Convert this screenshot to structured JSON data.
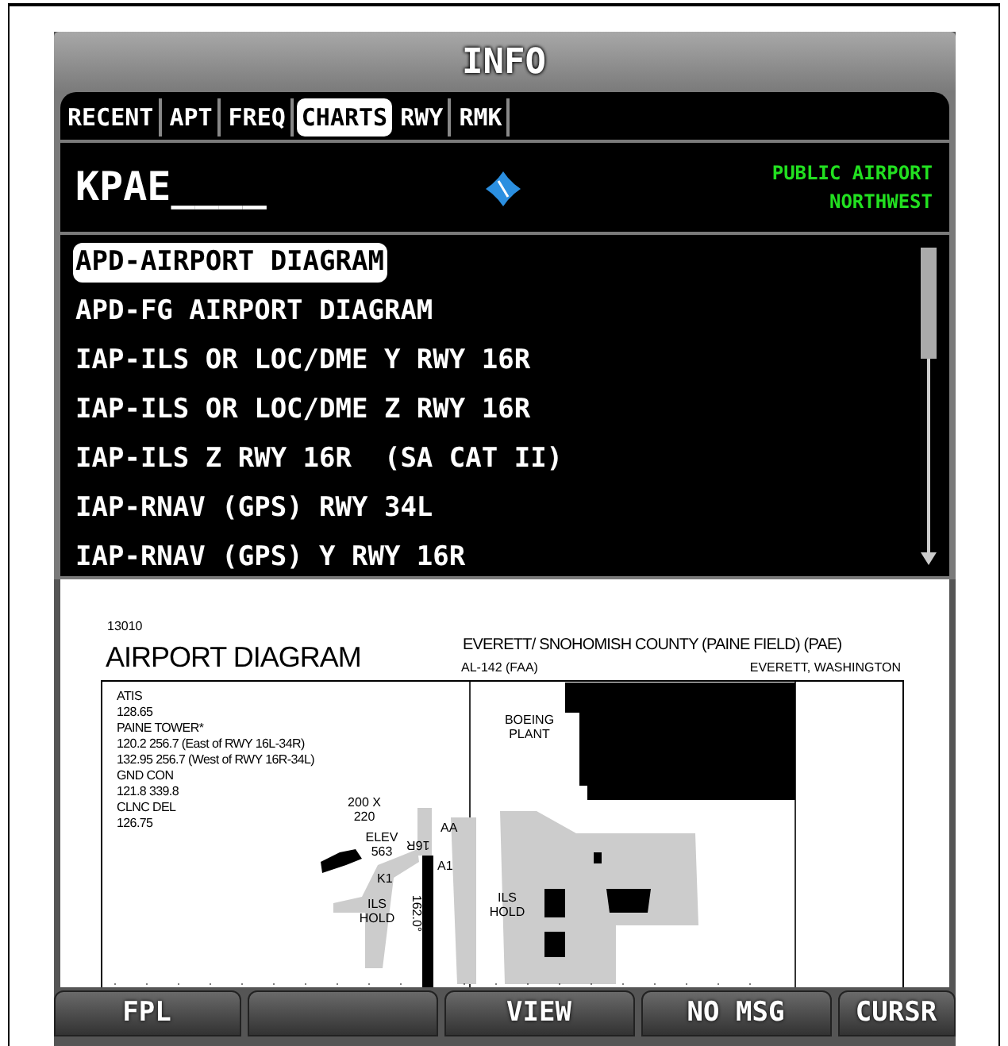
{
  "window": {
    "title": "INFO"
  },
  "tabs": [
    {
      "label": "RECENT",
      "selected": false
    },
    {
      "label": "APT",
      "selected": false
    },
    {
      "label": "FREQ",
      "selected": false
    },
    {
      "label": "CHARTS",
      "selected": true
    },
    {
      "label": "RWY",
      "selected": false
    },
    {
      "label": "RMK",
      "selected": false
    }
  ],
  "airport": {
    "identifier": "KPAE____",
    "type": "PUBLIC AIRPORT",
    "region": "NORTHWEST"
  },
  "chart_list": {
    "items": [
      {
        "label": "APD-AIRPORT DIAGRAM",
        "selected": true
      },
      {
        "label": "APD-FG AIRPORT DIAGRAM",
        "selected": false
      },
      {
        "label": "IAP-ILS OR LOC/DME Y RWY 16R",
        "selected": false
      },
      {
        "label": "IAP-ILS OR LOC/DME Z RWY 16R",
        "selected": false
      },
      {
        "label": "IAP-ILS Z RWY 16R  (SA CAT II)",
        "selected": false
      },
      {
        "label": "IAP-RNAV (GPS) RWY 34L",
        "selected": false
      },
      {
        "label": "IAP-RNAV (GPS) Y RWY 16R",
        "selected": false
      }
    ]
  },
  "chart_view": {
    "number": "13010",
    "title": "AIRPORT DIAGRAM",
    "airport_name": "EVERETT/ SNOHOMISH COUNTY (PAINE FIELD) (PAE)",
    "chart_id": "AL-142 (FAA)",
    "location": "EVERETT, WASHINGTON",
    "frequencies": [
      "ATIS",
      "128.65",
      "PAINE TOWER*",
      "120.2  256.7 (East of RWY 16L-34R)",
      "132.95  256.7 (West of RWY 16R-34L)",
      "GND CON",
      "121.8  339.8",
      "CLNC DEL",
      "126.75"
    ],
    "map_labels": [
      {
        "text": "BOEING PLANT"
      },
      {
        "text": "200 X 220"
      },
      {
        "text": "ELEV 563"
      },
      {
        "text": "16R"
      },
      {
        "text": "AA"
      },
      {
        "text": "A1"
      },
      {
        "text": "K1"
      },
      {
        "text": "ILS HOLD"
      },
      {
        "text": "ILS HOLD"
      },
      {
        "text": "162.0°"
      }
    ]
  },
  "softkeys": [
    {
      "kind": "labeled",
      "label": "FPL"
    },
    {
      "kind": "blank"
    },
    {
      "kind": "labeled",
      "label": "VIEW"
    },
    {
      "kind": "labeled",
      "label": "NO MSG"
    },
    {
      "kind": "labeled",
      "label": "CURSR"
    }
  ]
}
